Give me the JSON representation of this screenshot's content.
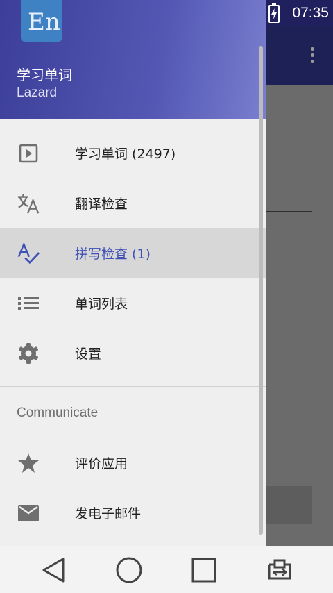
{
  "status_bar": {
    "time": "07:35",
    "icons": [
      "more-icon",
      "notification-badge-icon",
      "instagram-icon",
      "instagram-icon",
      "download-icon",
      "headphones-icon",
      "mute-icon",
      "wifi-icon",
      "no-sim-icon",
      "battery-icon"
    ]
  },
  "drawer": {
    "header": {
      "logo_text": "En",
      "title": "学习单词",
      "subtitle": "Lazard"
    },
    "items": [
      {
        "label": "学习单词  (2497)",
        "icon": "play-box-icon"
      },
      {
        "label": "翻译检查",
        "icon": "translate-icon"
      },
      {
        "label": "拼写检查 (1)",
        "icon": "spellcheck-icon"
      },
      {
        "label": "单词列表",
        "icon": "list-icon"
      },
      {
        "label": "设置",
        "icon": "gear-icon"
      }
    ],
    "section_title": "Communicate",
    "communicate_items": [
      {
        "label": "评价应用",
        "icon": "star-icon"
      },
      {
        "label": "发电子邮件",
        "icon": "mail-icon"
      }
    ]
  },
  "colors": {
    "header_start": "#3c3e98",
    "header_end": "#7a7fcf",
    "accent": "#3f51b5",
    "selected_bg": "#d7d7d7"
  },
  "nav_bar": {
    "buttons": [
      "back-icon",
      "home-icon",
      "recents-icon",
      "switch-app-icon"
    ]
  }
}
